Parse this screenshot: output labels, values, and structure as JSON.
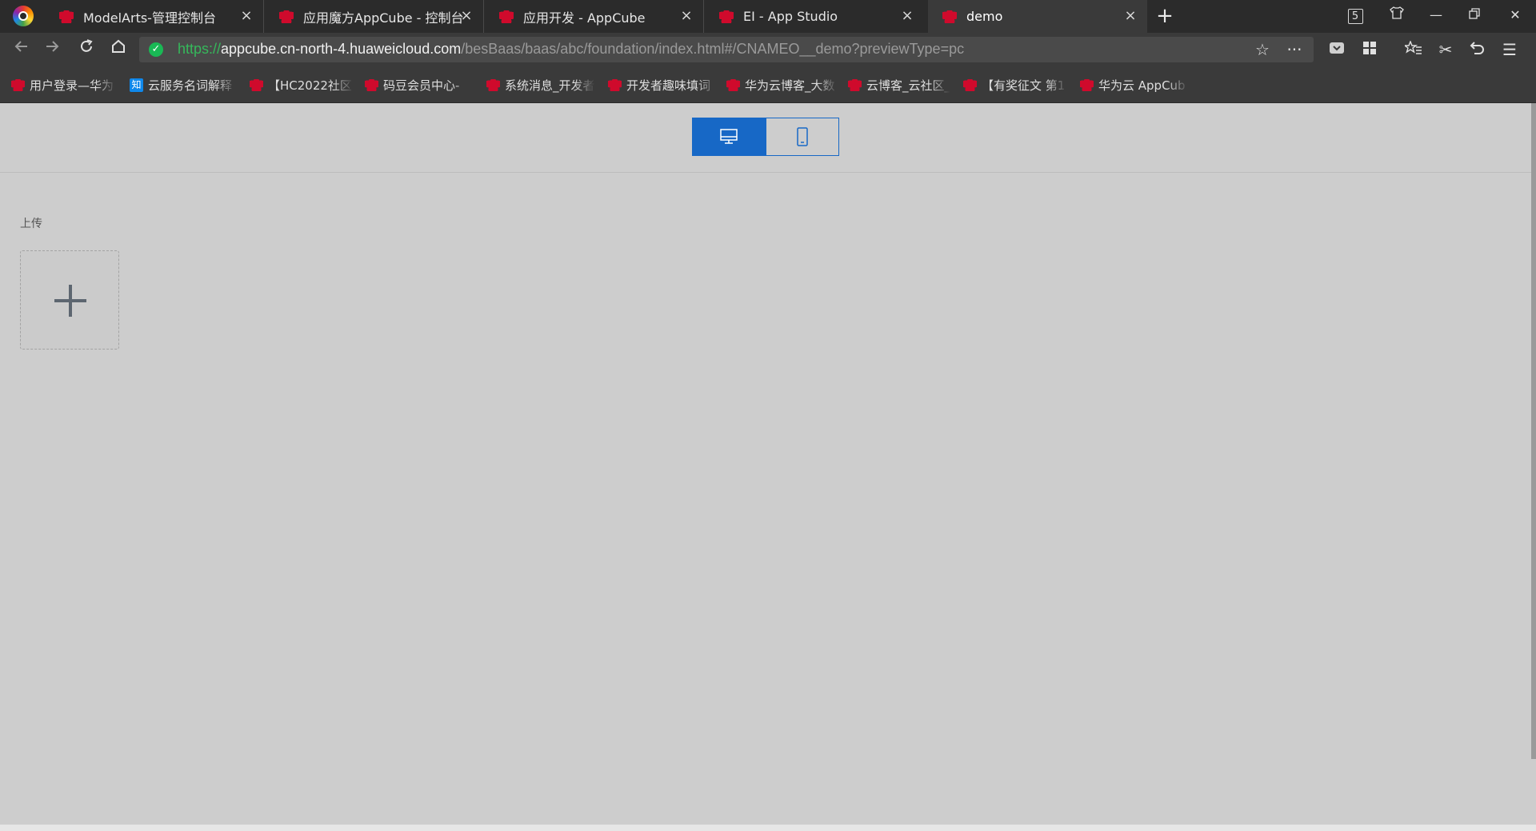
{
  "browser": {
    "tabs": [
      {
        "title": "ModelArts-管理控制台",
        "active": false
      },
      {
        "title": "应用魔方AppCube - 控制台",
        "active": false
      },
      {
        "title": "应用开发 - AppCube",
        "active": false
      },
      {
        "title": "EI - App Studio",
        "active": false
      },
      {
        "title": "demo",
        "active": true
      }
    ],
    "tab_count": "5",
    "url": {
      "scheme": "https://",
      "host": "appcube.cn-north-4.huaweicloud.com",
      "path": "/besBaas/baas/abc/foundation/index.html#/CNAMEO__demo?previewType=pc"
    },
    "bookmarks": [
      {
        "label": "用户登录—华为",
        "icon": "huawei-icon"
      },
      {
        "label": "云服务名词解释",
        "icon": "zhihu-icon"
      },
      {
        "label": "【HC2022社区",
        "icon": "huawei-icon"
      },
      {
        "label": "码豆会员中心-",
        "icon": "huawei-icon"
      },
      {
        "label": "系统消息_开发者",
        "icon": "huawei-icon"
      },
      {
        "label": "开发者趣味填词",
        "icon": "huawei-icon"
      },
      {
        "label": "华为云博客_大数",
        "icon": "huawei-icon"
      },
      {
        "label": "云博客_云社区_",
        "icon": "huawei-icon"
      },
      {
        "label": "【有奖征文 第1",
        "icon": "huawei-icon"
      },
      {
        "label": "华为云 AppCub",
        "icon": "huawei-icon"
      }
    ],
    "zhihu_glyph": "知"
  },
  "page": {
    "device_toggle": {
      "selected": "pc",
      "options": [
        "pc",
        "mobile"
      ]
    },
    "upload": {
      "label": "上传"
    }
  },
  "colors": {
    "accent": "#1768c6",
    "page_bg": "#cdcdcd",
    "chrome_bg": "#2b2b2b"
  }
}
